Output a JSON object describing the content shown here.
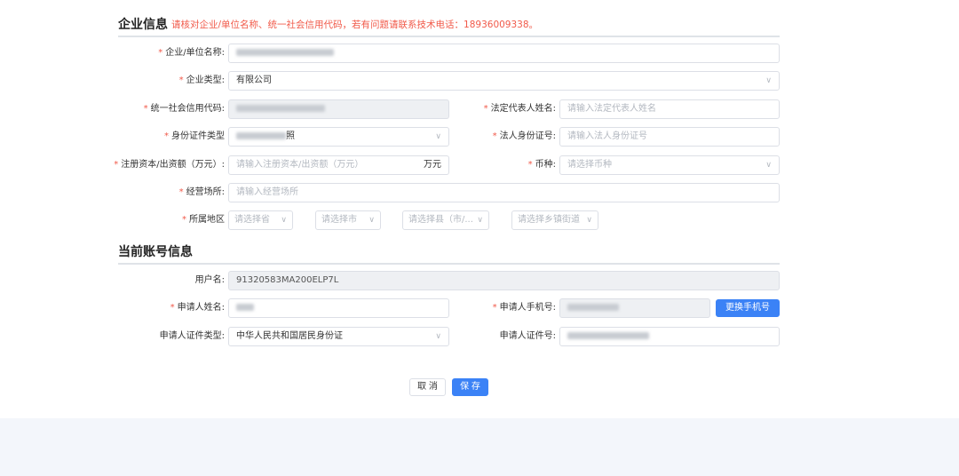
{
  "company_section": {
    "title": "企业信息",
    "tip": "请核对企业/单位名称、统一社会信用代码，若有问题请联系技术电话：18936009338。",
    "fields": {
      "company_name": {
        "label": "企业/单位名称:"
      },
      "company_type": {
        "label": "企业类型:",
        "value": "有限公司"
      },
      "credit_code": {
        "label": "统一社会信用代码:"
      },
      "legal_rep_name": {
        "label": "法定代表人姓名:",
        "placeholder": "请输入法定代表人姓名"
      },
      "id_type": {
        "label": "身份证件类型",
        "value_suffix": "照"
      },
      "legal_id": {
        "label": "法人身份证号:",
        "placeholder": "请输入法人身份证号"
      },
      "capital": {
        "label": "注册资本/出资额（万元）:",
        "placeholder": "请输入注册资本/出资额（万元）",
        "unit": "万元"
      },
      "currency": {
        "label": "币种:",
        "placeholder": "请选择币种"
      },
      "address": {
        "label": "经营场所:",
        "placeholder": "请输入经营场所"
      },
      "region": {
        "label": "所属地区",
        "province": "请选择省",
        "city": "请选择市",
        "county": "请选择县（市/...",
        "town": "请选择乡镇街道"
      }
    }
  },
  "account_section": {
    "title": "当前账号信息",
    "fields": {
      "username": {
        "label": "用户名:",
        "value": "91320583MA200ELP7L"
      },
      "applicant_name": {
        "label": "申请人姓名:"
      },
      "applicant_phone": {
        "label": "申请人手机号:"
      },
      "change_phone_button": "更换手机号",
      "applicant_id_type": {
        "label": "申请人证件类型:",
        "value": "中华人民共和国居民身份证"
      },
      "applicant_id": {
        "label": "申请人证件号:"
      }
    }
  },
  "actions": {
    "cancel": "取 消",
    "save": "保 存"
  },
  "colors": {
    "accent": "#3b82f6",
    "required": "#f15a4a",
    "tip": "#f15a4a"
  },
  "icons": {
    "select": "chevron-down-icon"
  }
}
